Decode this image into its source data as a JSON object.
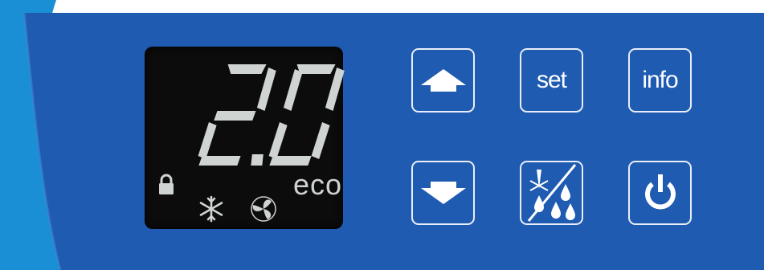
{
  "colors": {
    "panel_blue": "#1e5bb1",
    "edge_blue": "#1b8fd6",
    "lcd_background": "#0c0c0c",
    "lcd_segment": "#cfd3d2",
    "button_outline": "#e9eef8"
  },
  "display": {
    "temperature": "2.0",
    "mode_label": "eco",
    "indicators": [
      "lock-icon",
      "snowflake-icon",
      "fan-icon"
    ]
  },
  "buttons": {
    "up": {
      "icon": "arrow-up-icon"
    },
    "down": {
      "icon": "arrow-down-icon"
    },
    "set": {
      "label": "set"
    },
    "info": {
      "label": "info"
    },
    "defrost": {
      "icon": "defrost-drops-icon"
    },
    "power": {
      "icon": "power-icon"
    }
  }
}
